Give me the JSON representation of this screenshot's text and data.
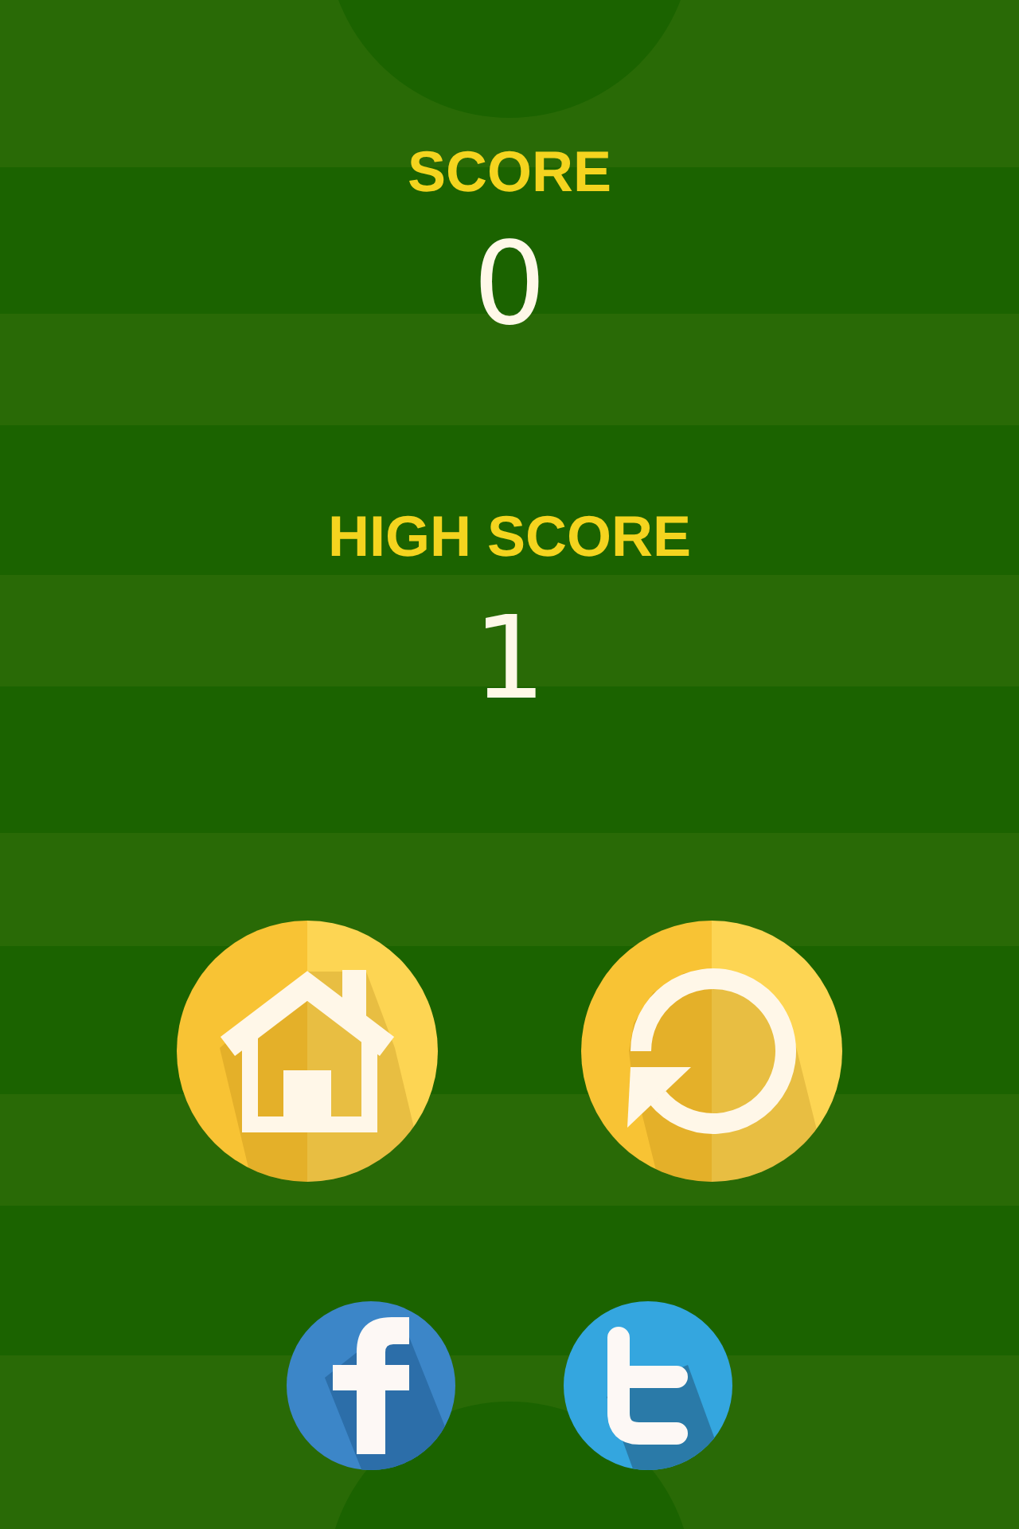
{
  "score": {
    "label": "SCORE",
    "value": "0"
  },
  "high_score": {
    "label": "HIGH SCORE",
    "value": "1"
  },
  "action_buttons": [
    {
      "kind": "home"
    },
    {
      "kind": "restart"
    }
  ],
  "share_buttons": [
    {
      "kind": "facebook"
    },
    {
      "kind": "twitter"
    }
  ]
}
